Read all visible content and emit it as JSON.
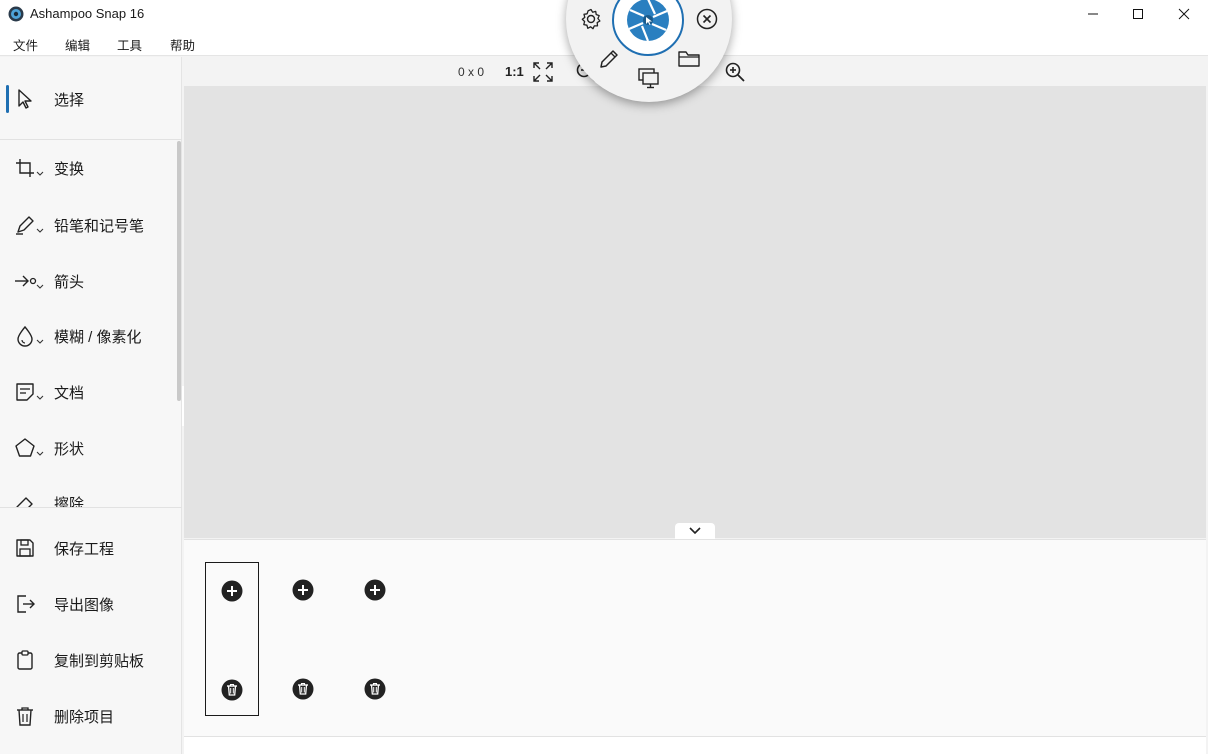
{
  "window": {
    "title": "Ashampoo Snap 16",
    "controls": {
      "minimize": "minimize-icon",
      "maximize": "maximize-icon",
      "close": "close-icon"
    }
  },
  "menu": {
    "items": [
      {
        "label": "文件"
      },
      {
        "label": "编辑"
      },
      {
        "label": "工具"
      },
      {
        "label": "帮助"
      }
    ]
  },
  "sidebar": {
    "selected": "选择",
    "tools": [
      {
        "label": "选择",
        "icon": "cursor-icon"
      },
      {
        "label": "变换",
        "icon": "crop-icon"
      },
      {
        "label": "铅笔和记号笔",
        "icon": "pen-icon"
      },
      {
        "label": "箭头",
        "icon": "arrow-icon"
      },
      {
        "label": "模糊 / 像素化",
        "icon": "droplet-icon"
      },
      {
        "label": "文档",
        "icon": "document-icon"
      },
      {
        "label": "形状",
        "icon": "pentagon-icon"
      },
      {
        "label": "擦除",
        "icon": "eraser-icon"
      }
    ],
    "actions": [
      {
        "label": "保存工程",
        "icon": "save-icon"
      },
      {
        "label": "导出图像",
        "icon": "export-icon"
      },
      {
        "label": "复制到剪贴板",
        "icon": "clipboard-icon"
      },
      {
        "label": "删除项目",
        "icon": "trash-icon"
      }
    ]
  },
  "toolbar": {
    "dimensions": "0 x 0",
    "zoom_label": "1:1"
  },
  "bottom_panel": {
    "slots": [
      {
        "selected": true
      },
      {
        "selected": false
      },
      {
        "selected": false
      }
    ]
  },
  "radial_menu": {
    "items": [
      "settings-icon",
      "capture-aperture-icon",
      "close-circle-icon",
      "edit-pencil-icon",
      "screens-icon",
      "folder-icon"
    ],
    "accent": "#1f6fb2"
  },
  "colors": {
    "accent": "#1f6fb2",
    "canvas": "#e3e3e3"
  }
}
